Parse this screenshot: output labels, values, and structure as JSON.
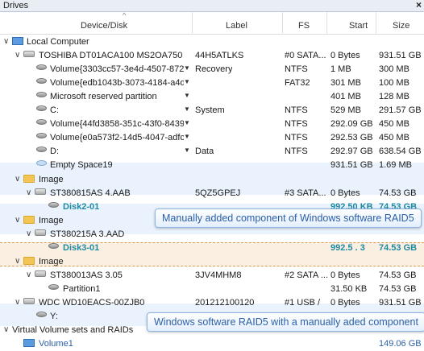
{
  "window": {
    "title": "Drives",
    "close": "×"
  },
  "columns": [
    "Device/Disk",
    "Label",
    "FS",
    "Start",
    "Size"
  ],
  "rows": [
    {
      "name": "Local Computer",
      "label": "",
      "fs": "",
      "start": "",
      "size": ""
    },
    {
      "name": "TOSHIBA DT01ACA100 MS2OA750",
      "label": "44H5ATLKS",
      "fs": "#0 SATA...",
      "start": "0 Bytes",
      "size": "931.51 GB"
    },
    {
      "name": "Volume{3303cc57-3e4d-4507-872f-...",
      "label": "Recovery",
      "fs": "NTFS",
      "start": "1 MB",
      "size": "300 MB"
    },
    {
      "name": "Volume{edb1043b-3073-4184-a4d5-...",
      "label": "",
      "fs": "FAT32",
      "start": "301 MB",
      "size": "100 MB"
    },
    {
      "name": "Microsoft reserved partition",
      "label": "",
      "fs": "",
      "start": "401 MB",
      "size": "128 MB"
    },
    {
      "name": "C:",
      "label": "System",
      "fs": "NTFS",
      "start": "529 MB",
      "size": "291.57 GB"
    },
    {
      "name": "Volume{44fd3858-351c-43f0-8439-1...",
      "label": "",
      "fs": "NTFS",
      "start": "292.09 GB",
      "size": "450 MB"
    },
    {
      "name": "Volume{e0a573f2-14d5-4047-adfc-3...",
      "label": "",
      "fs": "NTFS",
      "start": "292.53 GB",
      "size": "450 MB"
    },
    {
      "name": "D:",
      "label": "Data",
      "fs": "NTFS",
      "start": "292.97 GB",
      "size": "638.54 GB"
    },
    {
      "name": "Empty Space19",
      "label": "",
      "fs": "",
      "start": "931.51 GB",
      "size": "1.69 MB"
    },
    {
      "name": "Image",
      "label": "",
      "fs": "",
      "start": "",
      "size": ""
    },
    {
      "name": "ST380815AS 4.AAB",
      "label": "5QZ5GPEJ",
      "fs": "#3 SATA...",
      "start": "0 Bytes",
      "size": "74.53 GB"
    },
    {
      "name": "Disk2-01",
      "label": "",
      "fs": "",
      "start": "992.50 KB",
      "size": "74.53 GB"
    },
    {
      "name": "Image",
      "label": "",
      "fs": "",
      "start": "",
      "size": ""
    },
    {
      "name": "ST380215A 3.AAD",
      "label": "",
      "fs": "",
      "start": "",
      "size": ""
    },
    {
      "name": "Disk3-01",
      "label": "",
      "fs": "",
      "start": "992.5́ . 3",
      "size": "74.53 GB"
    },
    {
      "name": "Image",
      "label": "",
      "fs": "",
      "start": "",
      "size": ""
    },
    {
      "name": "ST380013AS 3.05",
      "label": "3JV4MHM8",
      "fs": "#2 SATA ...",
      "start": "0 Bytes",
      "size": "74.53 GB"
    },
    {
      "name": "Partition1",
      "label": "",
      "fs": "",
      "start": "31.50 KB",
      "size": "74.53 GB"
    },
    {
      "name": "WDC WD10EACS-00ZJB0",
      "label": "201212100120",
      "fs": "#1 USB /",
      "start": "0 Bytes",
      "size": "931.51 GB"
    },
    {
      "name": "Y:",
      "label": "",
      "fs": "",
      "start": "",
      "size": ""
    },
    {
      "name": "Virtual Volume sets and RAIDs",
      "label": "",
      "fs": "",
      "start": "",
      "size": ""
    },
    {
      "name": "Volume1",
      "label": "",
      "fs": "",
      "start": "",
      "size": "149.06 GB"
    }
  ],
  "callouts": {
    "top": "Manually added component of Windows software RAID5",
    "bottom": "Windows software RAID5 with a manually aded component"
  }
}
